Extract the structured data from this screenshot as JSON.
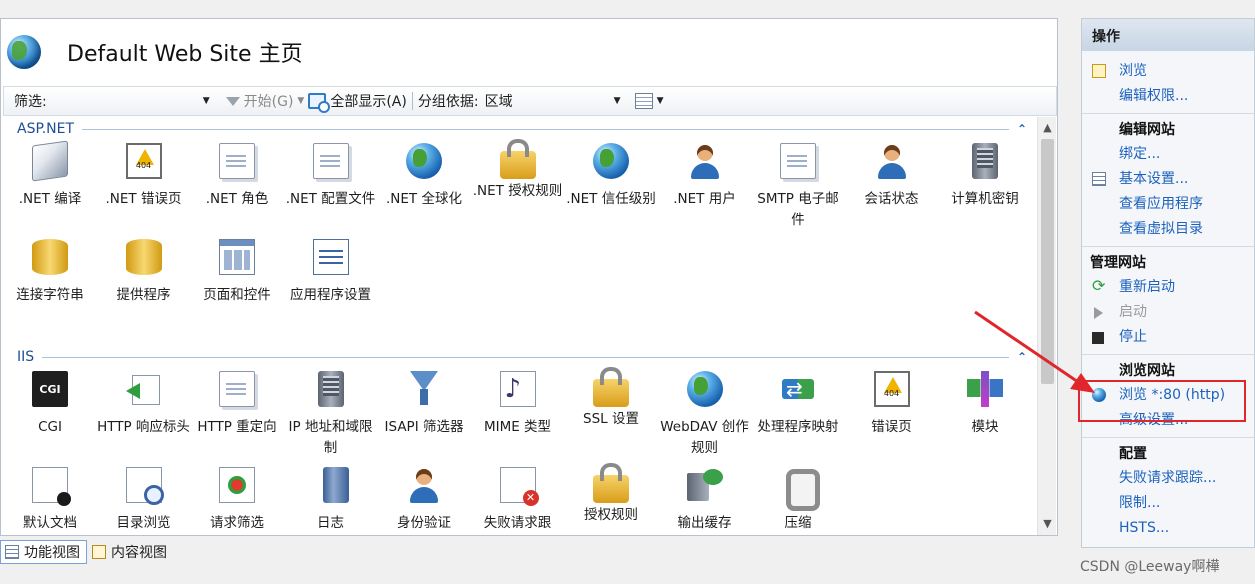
{
  "header": {
    "title": "Default Web Site 主页"
  },
  "toolbar": {
    "filter_label": "筛选:",
    "filter_value": "",
    "start_label": "开始(G)",
    "show_all_label": "全部显示(A)",
    "group_by_label": "分组依据:",
    "group_by_value": "区域"
  },
  "groups": [
    {
      "title": "ASP.NET",
      "features": [
        {
          "label": ".NET 编译",
          "icon": "compilation-icon"
        },
        {
          "label": ".NET 错误页",
          "icon": "error-page-404-icon"
        },
        {
          "label": ".NET 角色",
          "icon": "roles-icon"
        },
        {
          "label": ".NET 配置文件",
          "icon": "profile-icon"
        },
        {
          "label": ".NET 全球化",
          "icon": "globalization-icon"
        },
        {
          "label": ".NET 授权规则",
          "icon": "authorization-rules-icon"
        },
        {
          "label": ".NET 信任级别",
          "icon": "trust-levels-icon"
        },
        {
          "label": ".NET 用户",
          "icon": "users-icon"
        },
        {
          "label": "SMTP 电子邮件",
          "icon": "smtp-email-icon"
        },
        {
          "label": "会话状态",
          "icon": "session-state-icon"
        },
        {
          "label": "计算机密钥",
          "icon": "machine-key-icon"
        },
        {
          "label": "连接字符串",
          "icon": "connection-strings-icon"
        },
        {
          "label": "提供程序",
          "icon": "providers-icon"
        },
        {
          "label": "页面和控件",
          "icon": "pages-controls-icon"
        },
        {
          "label": "应用程序设置",
          "icon": "app-settings-icon"
        }
      ]
    },
    {
      "title": "IIS",
      "features": [
        {
          "label": "CGI",
          "icon": "cgi-icon",
          "icon_text": "CGI"
        },
        {
          "label": "HTTP 响应标头",
          "icon": "http-response-headers-icon"
        },
        {
          "label": "HTTP 重定向",
          "icon": "http-redirect-icon"
        },
        {
          "label": "IP 地址和域限制",
          "icon": "ip-domain-restrictions-icon"
        },
        {
          "label": "ISAPI 筛选器",
          "icon": "isapi-filters-icon"
        },
        {
          "label": "MIME 类型",
          "icon": "mime-types-icon"
        },
        {
          "label": "SSL 设置",
          "icon": "ssl-settings-icon"
        },
        {
          "label": "WebDAV 创作规则",
          "icon": "webdav-icon"
        },
        {
          "label": "处理程序映射",
          "icon": "handler-mappings-icon"
        },
        {
          "label": "错误页",
          "icon": "error-pages-icon"
        },
        {
          "label": "模块",
          "icon": "modules-icon"
        },
        {
          "label": "默认文档",
          "icon": "default-document-icon"
        },
        {
          "label": "目录浏览",
          "icon": "directory-browsing-icon"
        },
        {
          "label": "请求筛选",
          "icon": "request-filtering-icon"
        },
        {
          "label": "日志",
          "icon": "logging-icon"
        },
        {
          "label": "身份验证",
          "icon": "authentication-icon"
        },
        {
          "label": "失败请求跟",
          "icon": "failed-request-tracing-icon"
        },
        {
          "label": "授权规则",
          "icon": "authorization-icon"
        },
        {
          "label": "输出缓存",
          "icon": "output-caching-icon"
        },
        {
          "label": "压缩",
          "icon": "compression-icon"
        }
      ]
    }
  ],
  "view_tabs": [
    {
      "label": "功能视图",
      "active": true
    },
    {
      "label": "内容视图",
      "active": false
    }
  ],
  "actions": {
    "title": "操作",
    "sections": [
      {
        "heading": "",
        "items": [
          {
            "label": "浏览",
            "icon": "browse-folder-icon"
          },
          {
            "label": "编辑权限...",
            "icon": ""
          }
        ]
      },
      {
        "heading": "编辑网站",
        "items": [
          {
            "label": "绑定...",
            "icon": ""
          },
          {
            "label": "基本设置...",
            "icon": "basic-settings-icon"
          },
          {
            "label": "查看应用程序",
            "icon": ""
          },
          {
            "label": "查看虚拟目录",
            "icon": ""
          }
        ]
      },
      {
        "heading": "管理网站",
        "top": true,
        "items": [
          {
            "label": "重新启动",
            "icon": "restart-icon"
          },
          {
            "label": "启动",
            "icon": "start-icon",
            "disabled": true
          },
          {
            "label": "停止",
            "icon": "stop-icon"
          }
        ]
      },
      {
        "heading": "浏览网站",
        "items": [
          {
            "label": "浏览 *:80 (http)",
            "icon": "browse-globe-icon"
          },
          {
            "label": "高级设置...",
            "icon": ""
          }
        ]
      },
      {
        "heading": "配置",
        "items": [
          {
            "label": "失败请求跟踪...",
            "icon": ""
          },
          {
            "label": "限制...",
            "icon": ""
          },
          {
            "label": "HSTS...",
            "icon": ""
          }
        ]
      }
    ]
  },
  "watermark": "CSDN @Leeway啊樺",
  "annotation_color": "#e0262a"
}
